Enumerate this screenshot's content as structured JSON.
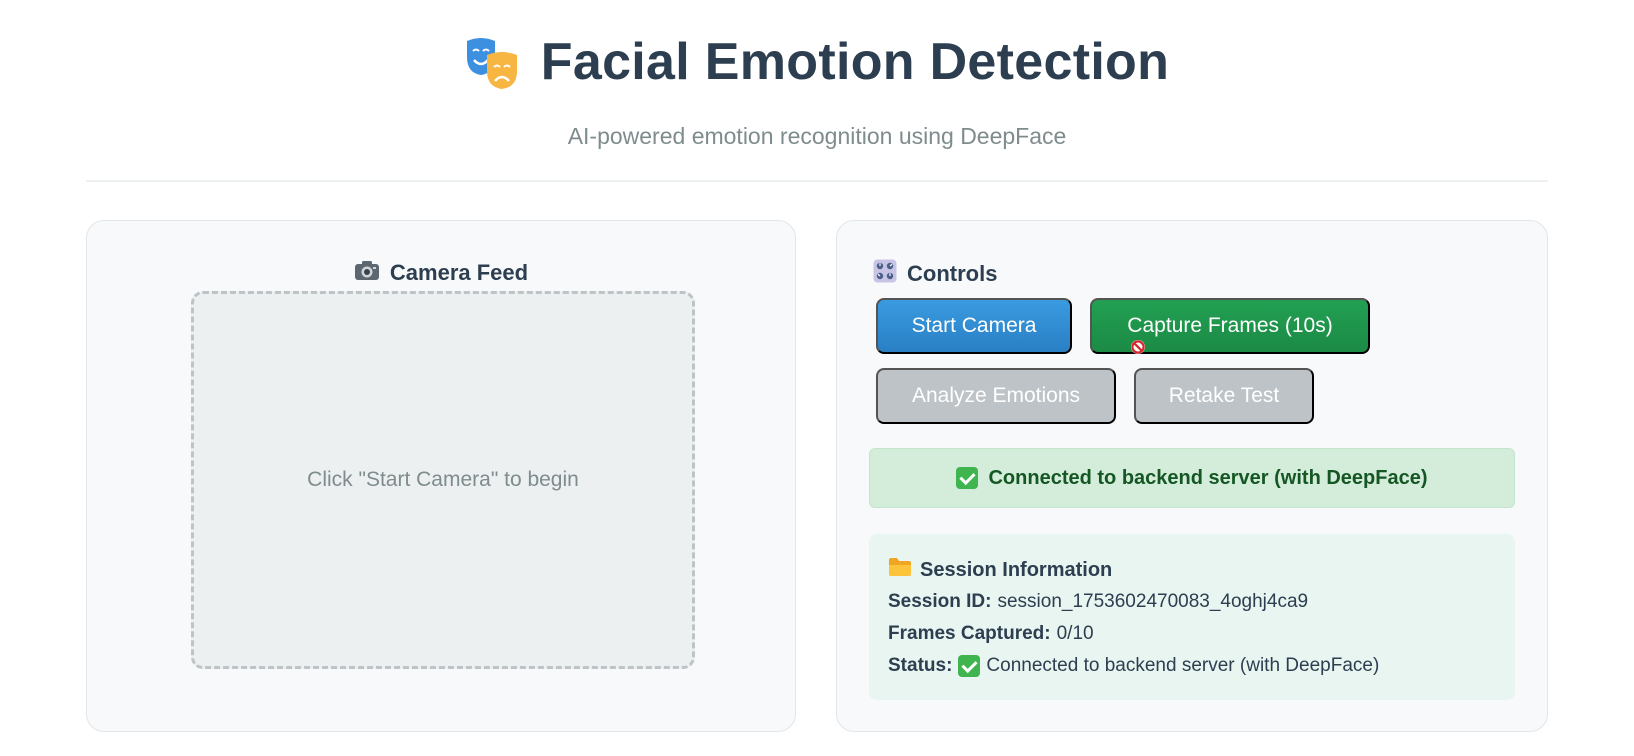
{
  "header": {
    "title": "Facial Emotion Detection",
    "subtitle": "AI-powered emotion recognition using DeepFace",
    "logo_icon": "performing-arts-masks-icon"
  },
  "camera_panel": {
    "title": "Camera Feed",
    "title_icon": "camera-icon",
    "placeholder": "Click \"Start Camera\" to begin"
  },
  "controls_panel": {
    "title": "Controls",
    "title_icon": "control-knobs-icon",
    "buttons": {
      "start_camera": "Start Camera",
      "capture_frames": "Capture Frames (10s)",
      "analyze_emotions": "Analyze Emotions",
      "retake_test": "Retake Test"
    },
    "status_message": "Connected to backend server (with DeepFace)"
  },
  "session": {
    "title": "Session Information",
    "title_icon": "folder-icon",
    "session_id_label": "Session ID:",
    "session_id": "session_1753602470083_4oghj4ca9",
    "frames_label": "Frames Captured:",
    "frames_value": "0/10",
    "status_label": "Status:",
    "status_value": "Connected to backend server (with DeepFace)"
  },
  "colors": {
    "primary_blue": "#3498db",
    "success_green": "#1e9a4d",
    "disabled_gray": "#bdc3c7",
    "status_bg": "#d4edda",
    "status_text": "#155724"
  }
}
